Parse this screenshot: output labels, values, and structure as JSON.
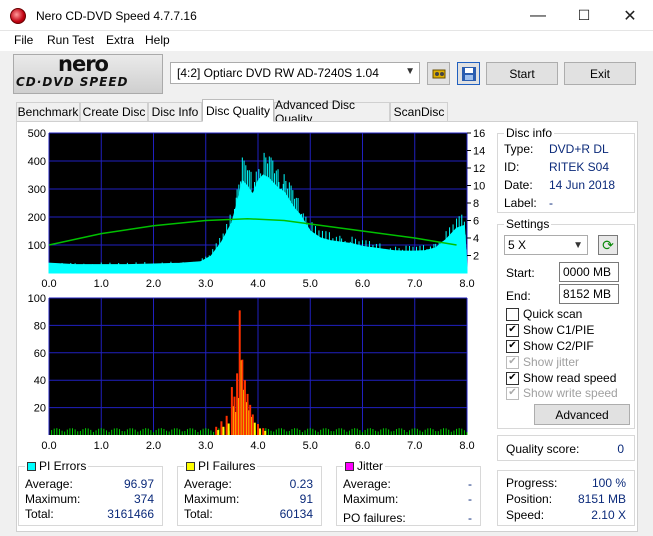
{
  "window": {
    "title": "Nero CD-DVD Speed 4.7.7.16",
    "minimize": "—",
    "maximize": "☐",
    "close": "✕"
  },
  "menu": [
    "File",
    "Run Test",
    "Extra",
    "Help"
  ],
  "toolbar": {
    "logo_top": "nero",
    "logo_bottom": "CD·DVD SPEED",
    "drive": "[4:2]  Optiarc DVD RW AD-7240S 1.04",
    "start_label": "Start",
    "exit_label": "Exit",
    "eject_icon": "eject-icon",
    "save_icon": "save-icon"
  },
  "tabs": [
    "Benchmark",
    "Create Disc",
    "Disc Info",
    "Disc Quality",
    "Advanced Disc Quality",
    "ScanDisc"
  ],
  "active_tab": "Disc Quality",
  "disc_info": {
    "title": "Disc info",
    "type_label": "Type:",
    "type": "DVD+R DL",
    "id_label": "ID:",
    "id": "RITEK S04",
    "date_label": "Date:",
    "date": "14 Jun 2018",
    "label_label": "Label:",
    "label": "-"
  },
  "settings": {
    "title": "Settings",
    "speed": "5 X",
    "start_label": "Start:",
    "start": "0000 MB",
    "end_label": "End:",
    "end": "8152 MB",
    "checkboxes": [
      {
        "label": "Quick scan",
        "checked": false,
        "enabled": true
      },
      {
        "label": "Show C1/PIE",
        "checked": true,
        "enabled": true
      },
      {
        "label": "Show C2/PIF",
        "checked": true,
        "enabled": true
      },
      {
        "label": "Show jitter",
        "checked": true,
        "enabled": false
      },
      {
        "label": "Show read speed",
        "checked": true,
        "enabled": true
      },
      {
        "label": "Show write speed",
        "checked": true,
        "enabled": false
      }
    ],
    "advanced_label": "Advanced"
  },
  "quality": {
    "label": "Quality score:",
    "value": "0"
  },
  "progress": {
    "progress_label": "Progress:",
    "progress": "100 %",
    "position_label": "Position:",
    "position": "8151 MB",
    "speed_label": "Speed:",
    "speed": "2.10 X"
  },
  "stats": {
    "pi_errors": {
      "title": "PI Errors",
      "color": "#00ffff",
      "average_label": "Average:",
      "average": "96.97",
      "maximum_label": "Maximum:",
      "maximum": "374",
      "total_label": "Total:",
      "total": "3161466"
    },
    "pi_failures": {
      "title": "PI Failures",
      "color": "#ffff00",
      "average_label": "Average:",
      "average": "0.23",
      "maximum_label": "Maximum:",
      "maximum": "91",
      "total_label": "Total:",
      "total": "60134"
    },
    "jitter": {
      "title": "Jitter",
      "color": "#ff00ff",
      "average_label": "Average:",
      "average": "-",
      "maximum_label": "Maximum:",
      "maximum": "-",
      "po_label": "PO failures:",
      "po": "-"
    }
  },
  "chart_data": [
    {
      "type": "area",
      "name": "PI Errors / read speed",
      "x_ticks": [
        "0.0",
        "1.0",
        "2.0",
        "3.0",
        "4.0",
        "5.0",
        "6.0",
        "7.0",
        "8.0"
      ],
      "y_ticks_left": [
        "500",
        "400",
        "300",
        "200",
        "100"
      ],
      "y_ticks_right": [
        "16",
        "14",
        "12",
        "10",
        "8",
        "6",
        "4",
        "2"
      ],
      "xlim": [
        0,
        8
      ],
      "ylim": [
        0,
        500
      ],
      "y2lim": [
        0,
        16
      ],
      "series": [
        {
          "color": "#00ffff",
          "x": [
            0,
            0.5,
            1,
            1.5,
            2,
            2.5,
            2.9,
            3.1,
            3.3,
            3.5,
            3.6,
            3.7,
            3.8,
            3.9,
            4.0,
            4.1,
            4.2,
            4.3,
            4.4,
            4.5,
            4.6,
            4.7,
            4.8,
            4.9,
            5.0,
            5.2,
            5.4,
            5.6,
            5.8,
            6.0,
            6.2,
            6.4,
            6.6,
            6.8,
            7.0,
            7.2,
            7.4,
            7.6,
            7.8,
            7.95,
            8.0
          ],
          "values": [
            35,
            30,
            30,
            30,
            32,
            35,
            40,
            60,
            110,
            180,
            250,
            330,
            310,
            280,
            330,
            350,
            340,
            320,
            300,
            290,
            260,
            230,
            210,
            180,
            150,
            125,
            115,
            110,
            105,
            95,
            90,
            85,
            80,
            78,
            78,
            80,
            90,
            120,
            160,
            170,
            20
          ]
        },
        {
          "color": "#00c000",
          "x": [
            0,
            1,
            2,
            3,
            3.8,
            4.5,
            5,
            6,
            7,
            7.8
          ],
          "values": [
            3.2,
            4.5,
            5.4,
            6.0,
            6.2,
            6.0,
            5.6,
            4.8,
            4.0,
            3.2
          ]
        }
      ]
    },
    {
      "type": "bar",
      "name": "PI Failures",
      "x_ticks": [
        "0.0",
        "1.0",
        "2.0",
        "3.0",
        "4.0",
        "5.0",
        "6.0",
        "7.0",
        "8.0"
      ],
      "y_ticks_left": [
        "100",
        "80",
        "60",
        "40",
        "20"
      ],
      "xlim": [
        0,
        8
      ],
      "ylim": [
        0,
        100
      ],
      "series": [
        {
          "color": "#ffff00",
          "x": [
            3.2,
            3.3,
            3.4,
            3.5,
            3.55,
            3.6,
            3.65,
            3.7,
            3.75,
            3.8,
            3.85,
            3.9,
            4.0,
            4.1
          ],
          "values": [
            6,
            10,
            14,
            35,
            28,
            45,
            91,
            55,
            40,
            30,
            22,
            15,
            8,
            5
          ]
        }
      ]
    }
  ]
}
